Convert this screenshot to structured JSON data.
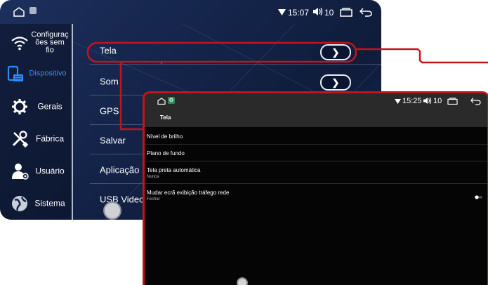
{
  "back": {
    "status": {
      "time": "15:07",
      "volume": "10"
    },
    "sidebar": [
      {
        "label": "Configuraç\nões sem\nfio",
        "icon": "wifi-icon"
      },
      {
        "label": "Dispositivo",
        "icon": "device-icon",
        "active": true
      },
      {
        "label": "Gerais",
        "icon": "gear-icon"
      },
      {
        "label": "Fábrica",
        "icon": "tools-icon"
      },
      {
        "label": "Usuário",
        "icon": "user-icon"
      },
      {
        "label": "Sistema",
        "icon": "globe-icon"
      }
    ],
    "menu": [
      {
        "label": "Tela",
        "arrow": true
      },
      {
        "label": "Som",
        "arrow": true
      },
      {
        "label": "GPS"
      },
      {
        "label": "Salvar"
      },
      {
        "label": "Aplicação"
      },
      {
        "label": "USB Video Ou"
      }
    ]
  },
  "front": {
    "status": {
      "time": "15:25",
      "volume": "10"
    },
    "title": "Tela",
    "rows": [
      {
        "title": "Nível de brilho"
      },
      {
        "title": "Plano de fundo"
      },
      {
        "title": "Tela preta automática",
        "subtitle": "Nunca"
      },
      {
        "title": "Mudar ecrã exibição tráfego rede",
        "subtitle": "Fechar",
        "toggle": false
      }
    ]
  },
  "colors": {
    "accent_red": "#c2151b",
    "active_blue": "#2f8cff",
    "back_bg": "#14244a",
    "front_bg": "#050505"
  }
}
